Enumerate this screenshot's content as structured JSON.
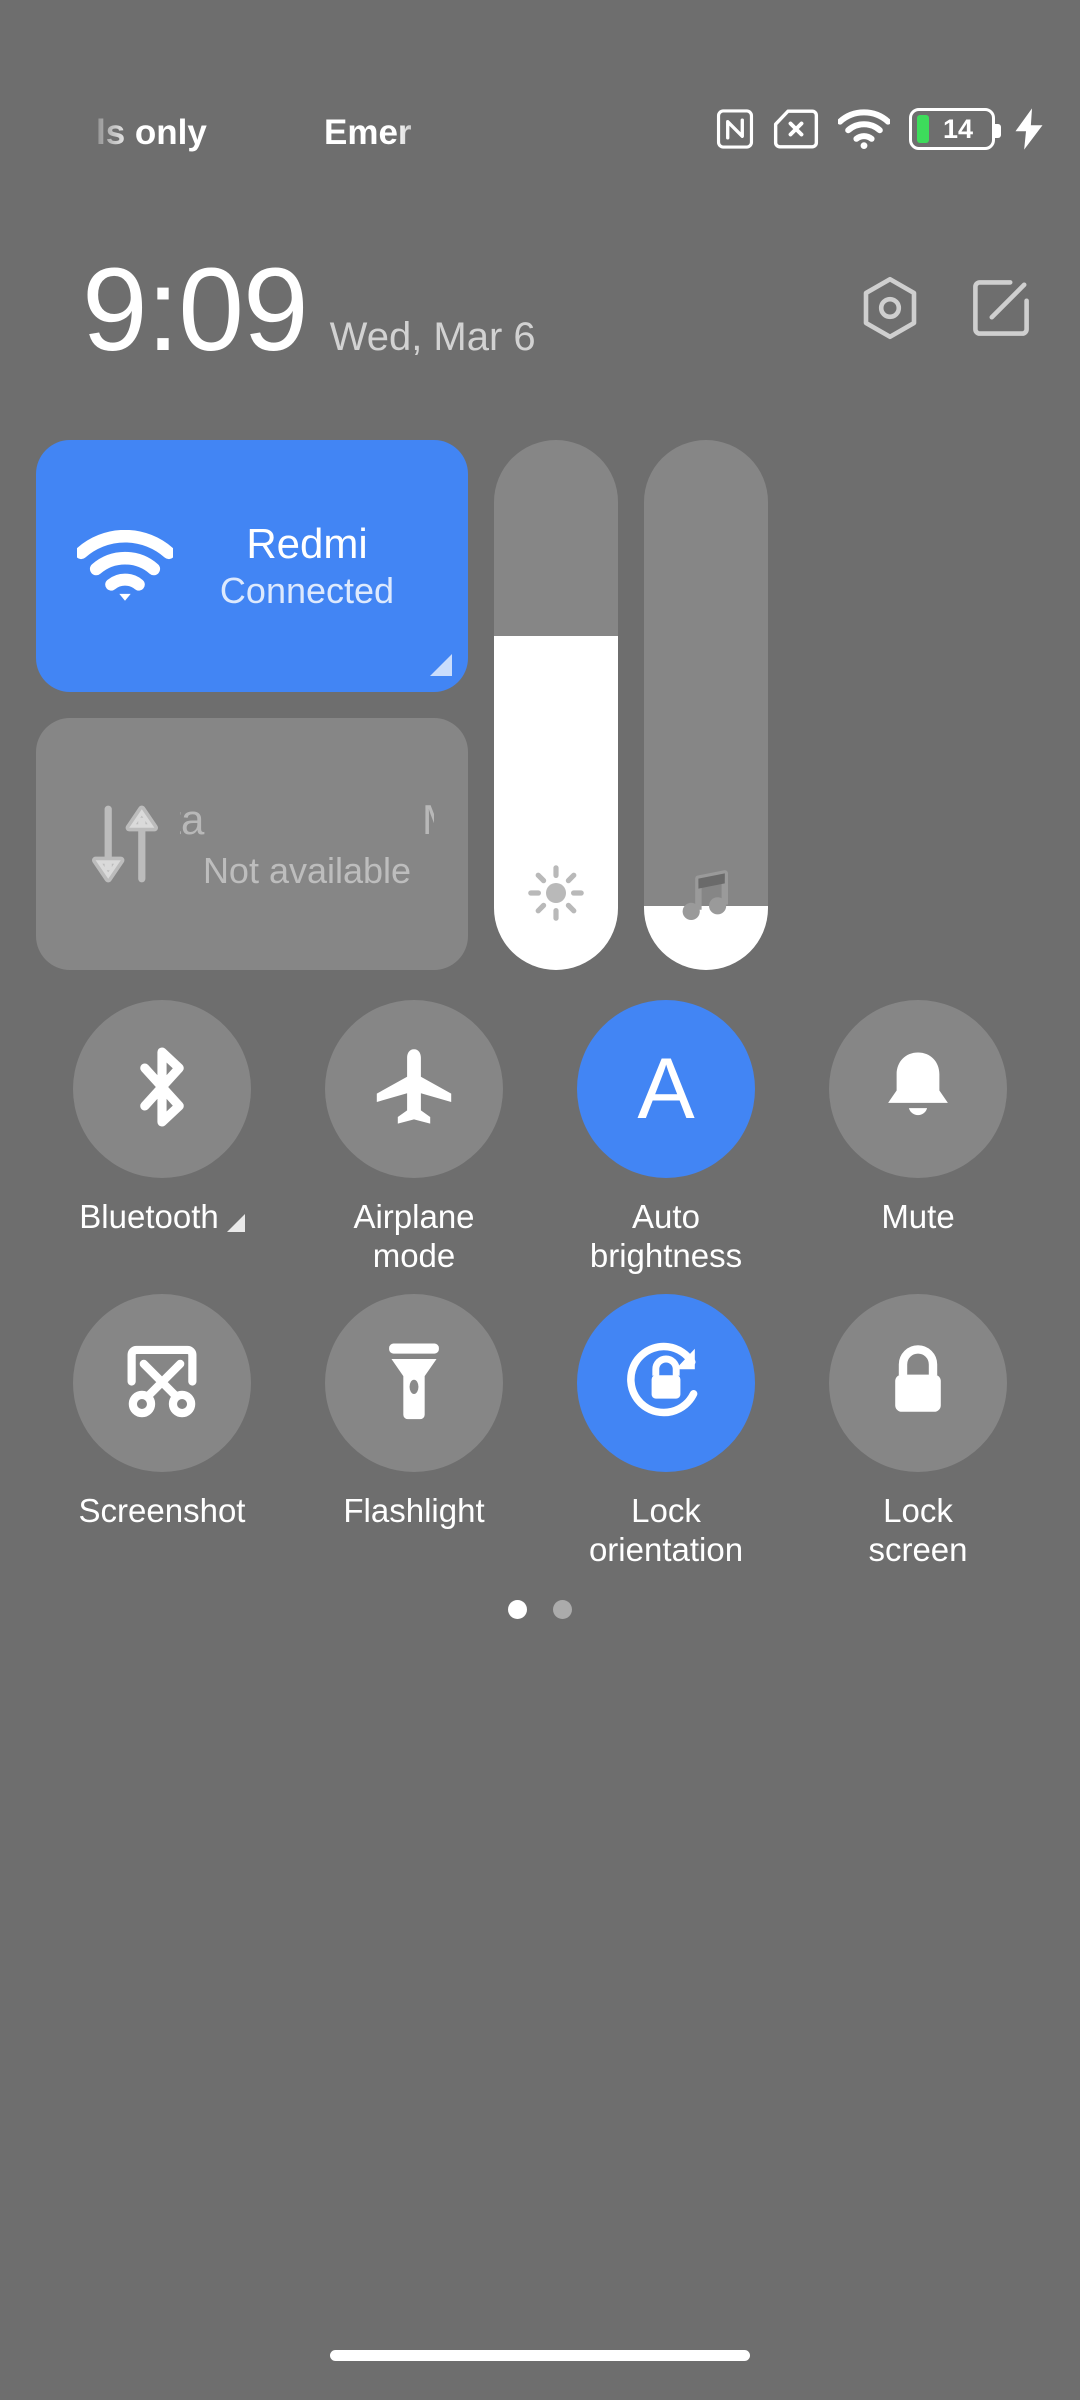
{
  "statusbar": {
    "carrier_left": "ls only",
    "carrier_right": "Emer",
    "icons": [
      "nfc-icon",
      "sim-missing-icon",
      "wifi-icon"
    ],
    "battery_level": "14",
    "charging": true
  },
  "header": {
    "time": "9:09",
    "date": "Wed, Mar 6",
    "settings_label": "settings-hex-icon",
    "edit_label": "edit-icon"
  },
  "connectivity": {
    "wifi": {
      "title": "Redmi",
      "subtitle": "Connected",
      "active": true
    },
    "mobile_data": {
      "title_part_a": "ata",
      "title_part_b": "Mob",
      "subtitle": "Not available",
      "active": false
    }
  },
  "sliders": {
    "brightness": {
      "name": "brightness-slider",
      "fill_percent": 63,
      "icon": "sun-icon"
    },
    "volume": {
      "name": "volume-slider",
      "fill_percent": 12,
      "icon": "music-note-icon"
    }
  },
  "toggles": [
    {
      "label": "Bluetooth",
      "icon": "bluetooth-icon",
      "active": false,
      "has_expand": true
    },
    {
      "label": "Airplane\nmode",
      "icon": "airplane-icon",
      "active": false,
      "has_expand": false
    },
    {
      "label": "Auto\nbrightness",
      "icon": "auto-brightness-icon",
      "active": true,
      "has_expand": false
    },
    {
      "label": "Mute",
      "icon": "bell-icon",
      "active": false,
      "has_expand": false
    },
    {
      "label": "Screenshot",
      "icon": "screenshot-icon",
      "active": false,
      "has_expand": false
    },
    {
      "label": "Flashlight",
      "icon": "flashlight-icon",
      "active": false,
      "has_expand": false
    },
    {
      "label": "Lock\norientation",
      "icon": "lock-rotation-icon",
      "active": true,
      "has_expand": false
    },
    {
      "label": "Lock\nscreen",
      "icon": "lock-icon",
      "active": false,
      "has_expand": false
    }
  ],
  "pager": {
    "pages": 2,
    "current": 1
  },
  "navbar": {
    "handle": "home-gesture-pill"
  },
  "colors": {
    "background": "#6e6e6e",
    "accent": "#4285f4",
    "tile_off": "rgba(255,255,255,0.17)",
    "battery_green": "#3ddc5b",
    "text_primary": "#ffffff",
    "text_secondary": "#d2d2d2"
  }
}
